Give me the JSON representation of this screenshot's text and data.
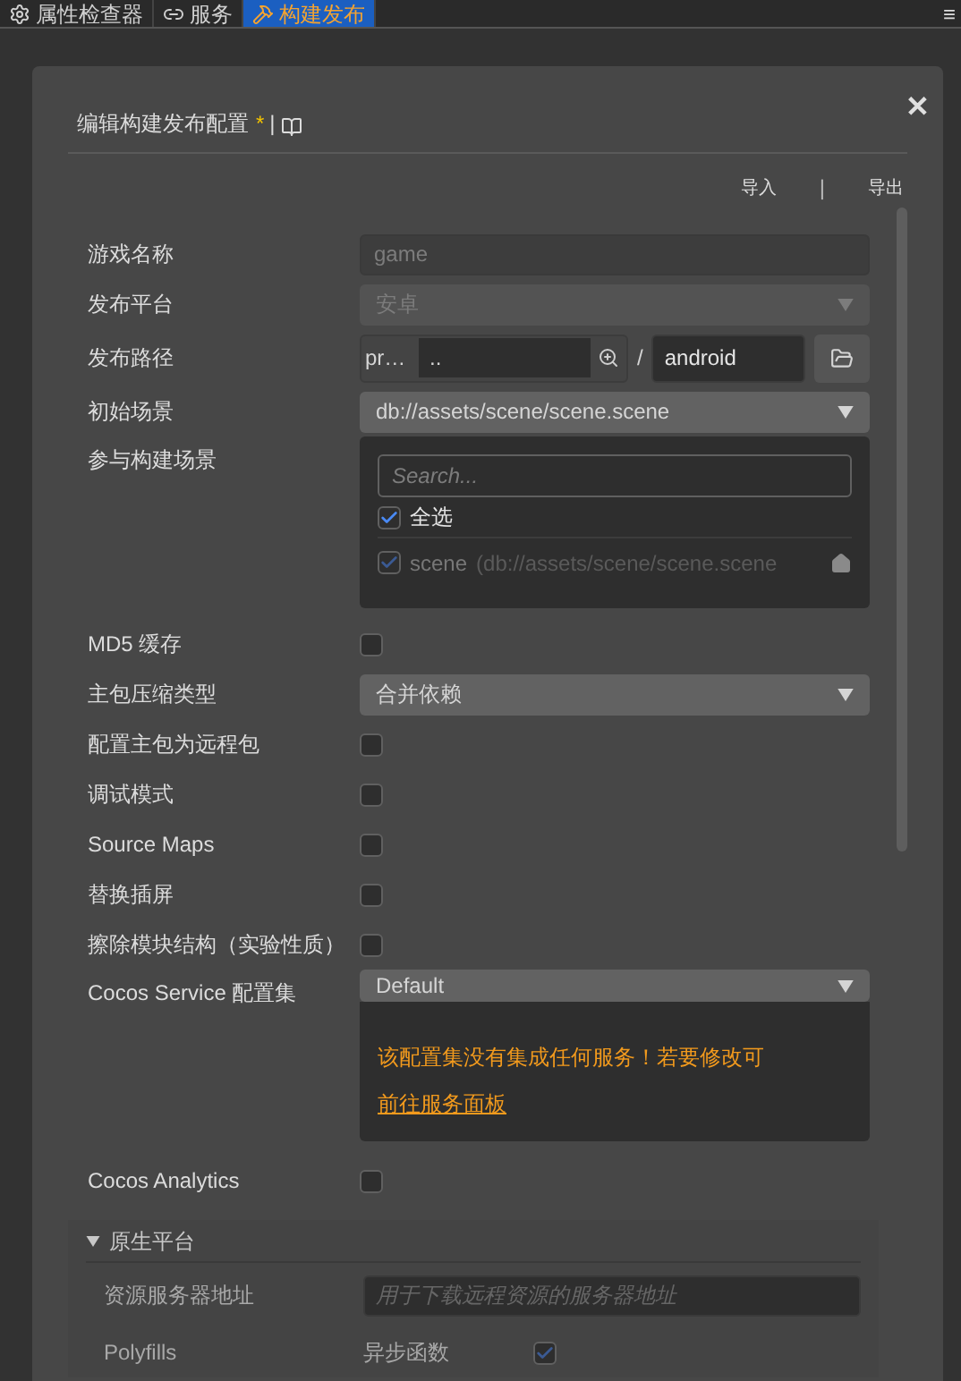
{
  "tabs": [
    {
      "label": "属性检查器",
      "selected": false
    },
    {
      "label": "服务",
      "selected": false
    },
    {
      "label": "构建发布",
      "selected": true
    }
  ],
  "menu_icon": "≡",
  "dialog": {
    "title": "编辑构建发布配置",
    "modified_mark": "*",
    "separator": "|",
    "close": "✕",
    "actions": [
      {
        "label": "导入"
      },
      {
        "label": "导出"
      }
    ],
    "action_separator": "|",
    "fields": [
      {
        "kind": "text",
        "label": "游戏名称",
        "placeholder": "game"
      },
      {
        "kind": "select",
        "label": "发布平台",
        "value": "安卓",
        "disabled": true
      },
      {
        "kind": "path",
        "label": "发布路径",
        "prefix": "pr…",
        "value": "..",
        "separator": "/",
        "folder": "android"
      },
      {
        "kind": "select",
        "label": "初始场景",
        "value": "db://assets/scene/scene.scene",
        "disabled": false
      },
      {
        "kind": "scenes",
        "label": "参与构建场景",
        "placeholder": "Search...",
        "select_all": {
          "label": "全选",
          "checked": true
        },
        "scenes": [
          {
            "name": "scene",
            "path": "(db://assets/scene/scene.scene",
            "checked": true
          }
        ]
      },
      {
        "kind": "checkbox",
        "label": "MD5 缓存",
        "checked": false
      },
      {
        "kind": "select",
        "label": "主包压缩类型",
        "value": "合并依赖",
        "disabled": false
      },
      {
        "kind": "checkbox",
        "label": "配置主包为远程包",
        "checked": false
      },
      {
        "kind": "checkbox",
        "label": "调试模式",
        "checked": false
      },
      {
        "kind": "checkbox",
        "label": "Source Maps",
        "checked": false
      },
      {
        "kind": "checkbox",
        "label": "替换插屏",
        "checked": false
      },
      {
        "kind": "checkbox",
        "label": "擦除模块结构（实验性质）",
        "checked": false
      },
      {
        "kind": "service",
        "label": "Cocos Service 配置集",
        "value": "Default",
        "disabled": false,
        "message": "该配置集没有集成任何服务！若要修改可",
        "link": "前往服务面板"
      },
      {
        "kind": "checkbox",
        "label": "Cocos Analytics",
        "checked": false
      }
    ],
    "section": {
      "title": "原生平台",
      "expanded": true,
      "rows": [
        {
          "kind": "text",
          "label": "资源服务器地址",
          "placeholder": "用于下载远程资源的服务器地址"
        },
        {
          "kind": "option",
          "label": "Polyfills",
          "option": "异步函数",
          "checked": true
        }
      ]
    }
  }
}
